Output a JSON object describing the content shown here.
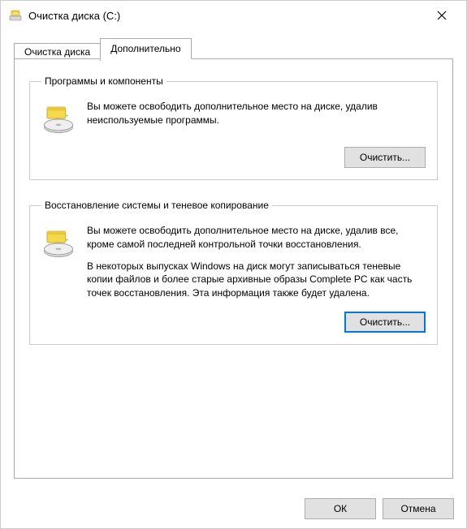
{
  "window": {
    "title": "Очистка диска  (C:)",
    "close_label": "Close"
  },
  "tabs": {
    "cleanup": "Очистка диска",
    "advanced": "Дополнительно"
  },
  "groups": {
    "programs": {
      "legend": "Программы и компоненты",
      "text1": "Вы можете освободить дополнительное место на диске, удалив неиспользуемые программы.",
      "button": "Очистить..."
    },
    "restore": {
      "legend": "Восстановление системы и теневое копирование",
      "text1": "Вы можете освободить дополнительное место на диске, удалив все, кроме самой последней контрольной точки восстановления.",
      "text2": "В некоторых выпусках Windows на диск могут записываться теневые копии файлов и более старые архивные образы Complete PC как часть точек восстановления. Эта информация также будет удалена.",
      "button": "Очистить..."
    }
  },
  "footer": {
    "ok": "ОК",
    "cancel": "Отмена"
  }
}
